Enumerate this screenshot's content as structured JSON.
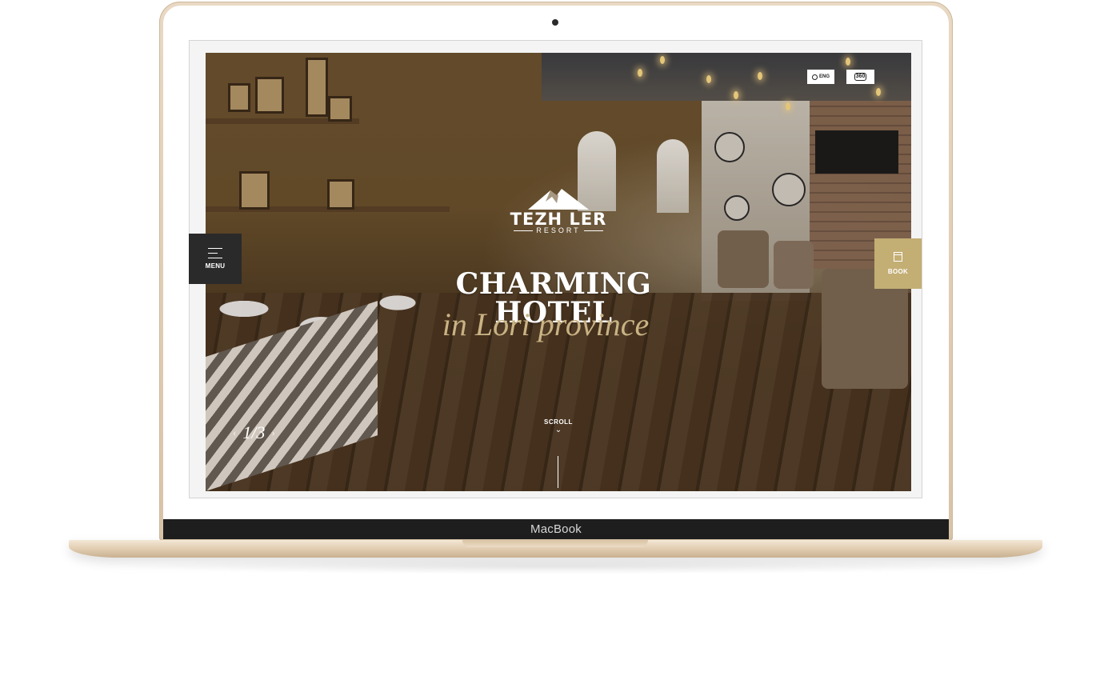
{
  "device": {
    "brand_label": "MacBook"
  },
  "site": {
    "logo": {
      "name": "TEZH LER",
      "subtitle": "RESORT"
    },
    "language_button": {
      "label": "ENG"
    },
    "view_button": {
      "label": "360"
    },
    "menu_button": {
      "label": "MENU"
    },
    "book_button": {
      "label": "BOOK"
    },
    "hero": {
      "title": "CHARMING HOTEL",
      "subtitle": "in Lori province",
      "slide_counter": "1/3",
      "prev_arrow": "‹",
      "next_arrow": "›",
      "scroll_label": "SCROLL"
    }
  },
  "colors": {
    "accent_gold": "#c3ae74",
    "menu_bg": "#2a2a2a",
    "laptop_gold": "#e3cfb4"
  },
  "icons": [
    "globe-icon",
    "view-360-icon",
    "hamburger-icon",
    "calendar-icon",
    "chevron-down-icon",
    "mountain-logo-icon"
  ]
}
